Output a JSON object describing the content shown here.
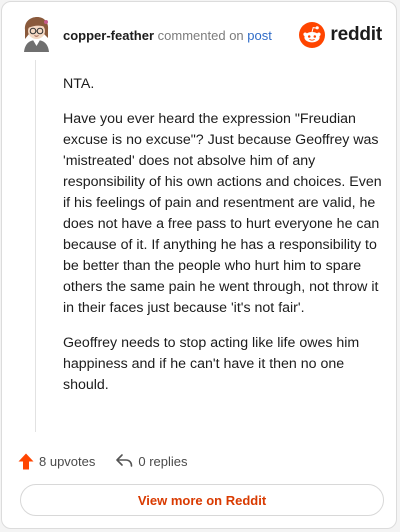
{
  "comment": {
    "author": "copper-feather",
    "action": "commented on",
    "target": "post",
    "paragraphs": [
      "NTA.",
      "Have you ever heard the expression \"Freudian excuse is no excuse\"? Just because Geoffrey was 'mistreated' does not absolve him of any responsibility of his own actions and choices. Even if his feelings of pain and resentment are valid, he does not have a free pass to hurt everyone he can because of it. If anything he has a responsibility to be better than the people who hurt him to spare others the same pain he went through, not throw it in their faces just because 'it's not fair'.",
      "Geoffrey needs to stop acting like life owes him happiness and if he can't have it then no one should."
    ]
  },
  "brand": {
    "wordmark": "reddit",
    "icon": "reddit-snoo-icon",
    "color": "#ff4500"
  },
  "footer": {
    "upvotes_label": "8 upvotes",
    "upvote_icon": "upvote-arrow-icon",
    "replies_label": "0 replies",
    "reply_icon": "reply-arrow-icon"
  },
  "cta": {
    "label": "View more on Reddit",
    "color": "#d93a00"
  },
  "colors": {
    "author": "#1c1c1c",
    "muted": "#7c7c7c",
    "link": "#2e6bc7",
    "upvote": "#ff4500"
  }
}
